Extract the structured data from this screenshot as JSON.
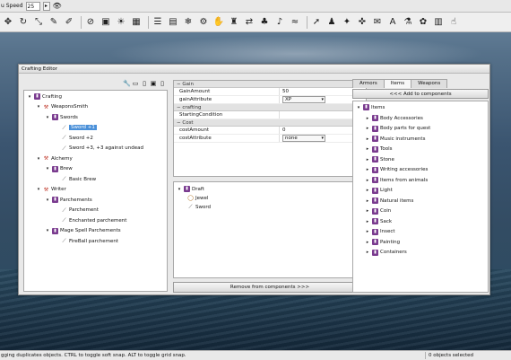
{
  "speed": {
    "label": "u Speed",
    "value": "25",
    "arrow": "▸"
  },
  "toolbar_icons": [
    "move-icon",
    "rotate-icon",
    "scale-icon",
    "paint-icon",
    "brush-icon",
    "no-icon",
    "frame-icon",
    "sun-icon",
    "grid-icon",
    "sliders-icon",
    "window-icon",
    "snowflake-icon",
    "gear-icon",
    "hand-icon",
    "shirt-icon",
    "arrows-icon",
    "tree-icon",
    "speaker-icon",
    "waves-icon",
    "pointer-icon",
    "person-icon",
    "sparkle-icon",
    "drag-icon",
    "chat-icon",
    "text-icon",
    "filter-icon",
    "flower-icon",
    "table-icon",
    "thumb-icon"
  ],
  "window": {
    "title": "Crafting Editor"
  },
  "tree": {
    "nodes": [
      {
        "label": "Crafting",
        "icon": "book",
        "depth": 0,
        "open": true,
        "selected": false
      },
      {
        "label": "WeaponsSmith",
        "icon": "hammer",
        "depth": 1,
        "open": true,
        "selected": false
      },
      {
        "label": "Swords",
        "icon": "book",
        "depth": 2,
        "open": true,
        "selected": false
      },
      {
        "label": "Sword +1",
        "icon": "sword",
        "depth": 3,
        "open": null,
        "selected": true
      },
      {
        "label": "Sword +2",
        "icon": "sword",
        "depth": 3,
        "open": null,
        "selected": false
      },
      {
        "label": "Sword +3, +3 against undead",
        "icon": "sword",
        "depth": 3,
        "open": null,
        "selected": false
      },
      {
        "label": "Alchemy",
        "icon": "hammer",
        "depth": 1,
        "open": true,
        "selected": false
      },
      {
        "label": "Brew",
        "icon": "book",
        "depth": 2,
        "open": true,
        "selected": false
      },
      {
        "label": "Basic Brew",
        "icon": "sword",
        "depth": 3,
        "open": null,
        "selected": false
      },
      {
        "label": "Writer",
        "icon": "hammer",
        "depth": 1,
        "open": true,
        "selected": false
      },
      {
        "label": "Parchements",
        "icon": "book",
        "depth": 2,
        "open": true,
        "selected": false
      },
      {
        "label": "Parchement",
        "icon": "sword",
        "depth": 3,
        "open": null,
        "selected": false
      },
      {
        "label": "Enchanted parchement",
        "icon": "sword",
        "depth": 3,
        "open": null,
        "selected": false
      },
      {
        "label": "Mage Spell Parchements",
        "icon": "book",
        "depth": 2,
        "open": true,
        "selected": false
      },
      {
        "label": "FireBall parchement",
        "icon": "sword",
        "depth": 3,
        "open": null,
        "selected": false
      }
    ]
  },
  "props": {
    "gain": {
      "section": "Gain",
      "rows": [
        {
          "k": "GainAmount",
          "v": "50"
        },
        {
          "k": "gainAttribute",
          "v": "XP"
        }
      ]
    },
    "crafting": {
      "section": "crafting",
      "rows": [
        {
          "k": "StartingCondition",
          "v": ""
        }
      ]
    },
    "cost": {
      "section": "Cost",
      "rows": [
        {
          "k": "costAmount",
          "v": "0"
        },
        {
          "k": "costAttribute",
          "v": "none"
        }
      ]
    }
  },
  "components": {
    "root": "Draft",
    "children": [
      "Jewel",
      "Sword"
    ]
  },
  "remove_button": "Remove from components >>>",
  "tabs": [
    "Armors",
    "Items",
    "Weapons"
  ],
  "active_tab": "Items",
  "add_button": "<<< Add to components",
  "items": {
    "root": "Items",
    "children": [
      "Body Accessories",
      "Body parts for quest",
      "Music instruments",
      "Tools",
      "Stone",
      "Writing accessories",
      "Items from animals",
      "Light",
      "Natural items",
      "Coin",
      "Sack",
      "Insect",
      "Painting",
      "Containers"
    ]
  },
  "status": {
    "left": "gging duplicates objects.  CTRL to toggle soft snap.  ALT to toggle grid snap.",
    "right": "0 objects selected"
  }
}
